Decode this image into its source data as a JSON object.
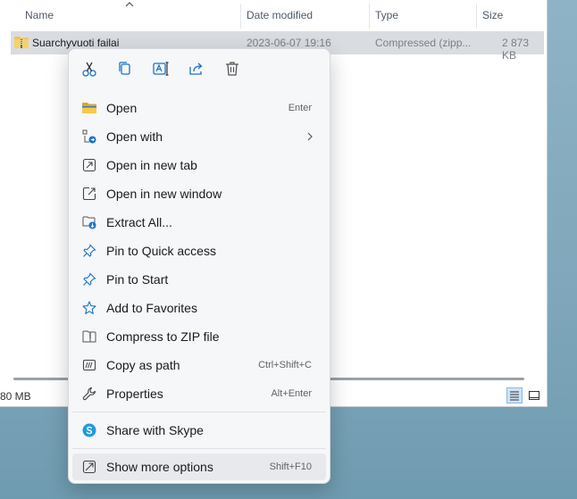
{
  "columns": {
    "name": "Name",
    "date": "Date modified",
    "type": "Type",
    "size": "Size"
  },
  "file": {
    "name": "Suarchyvuoti failai",
    "date": "2023-06-07 19:16",
    "type": "Compressed (zipp...",
    "size": "2 873 KB"
  },
  "status": {
    "text": "80 MB"
  },
  "menu": {
    "toolbar": [
      "cut-icon",
      "copy-icon",
      "rename-icon",
      "share-icon",
      "delete-icon"
    ],
    "items": [
      {
        "label": "Open",
        "shortcut": "Enter",
        "icon": "folder-open-icon"
      },
      {
        "label": "Open with",
        "shortcut": "",
        "icon": "open-with-icon"
      },
      {
        "label": "Open in new tab",
        "shortcut": "",
        "icon": "new-tab-icon"
      },
      {
        "label": "Open in new window",
        "shortcut": "",
        "icon": "new-window-icon"
      },
      {
        "label": "Extract All...",
        "shortcut": "",
        "icon": "extract-icon"
      },
      {
        "label": "Pin to Quick access",
        "shortcut": "",
        "icon": "pin-icon"
      },
      {
        "label": "Pin to Start",
        "shortcut": "",
        "icon": "pin-icon"
      },
      {
        "label": "Add to Favorites",
        "shortcut": "",
        "icon": "star-icon"
      },
      {
        "label": "Compress to ZIP file",
        "shortcut": "",
        "icon": "zip-icon"
      },
      {
        "label": "Copy as path",
        "shortcut": "Ctrl+Shift+C",
        "icon": "path-icon"
      },
      {
        "label": "Properties",
        "shortcut": "Alt+Enter",
        "icon": "wrench-icon"
      },
      {
        "label": "Share with Skype",
        "shortcut": "",
        "icon": "skype-icon"
      },
      {
        "label": "Show more options",
        "shortcut": "Shift+F10",
        "icon": "more-options-icon"
      }
    ]
  },
  "colors": {
    "accent": "#1a73c8",
    "folder": "#f2c14e",
    "skype": "#1e9be0"
  }
}
